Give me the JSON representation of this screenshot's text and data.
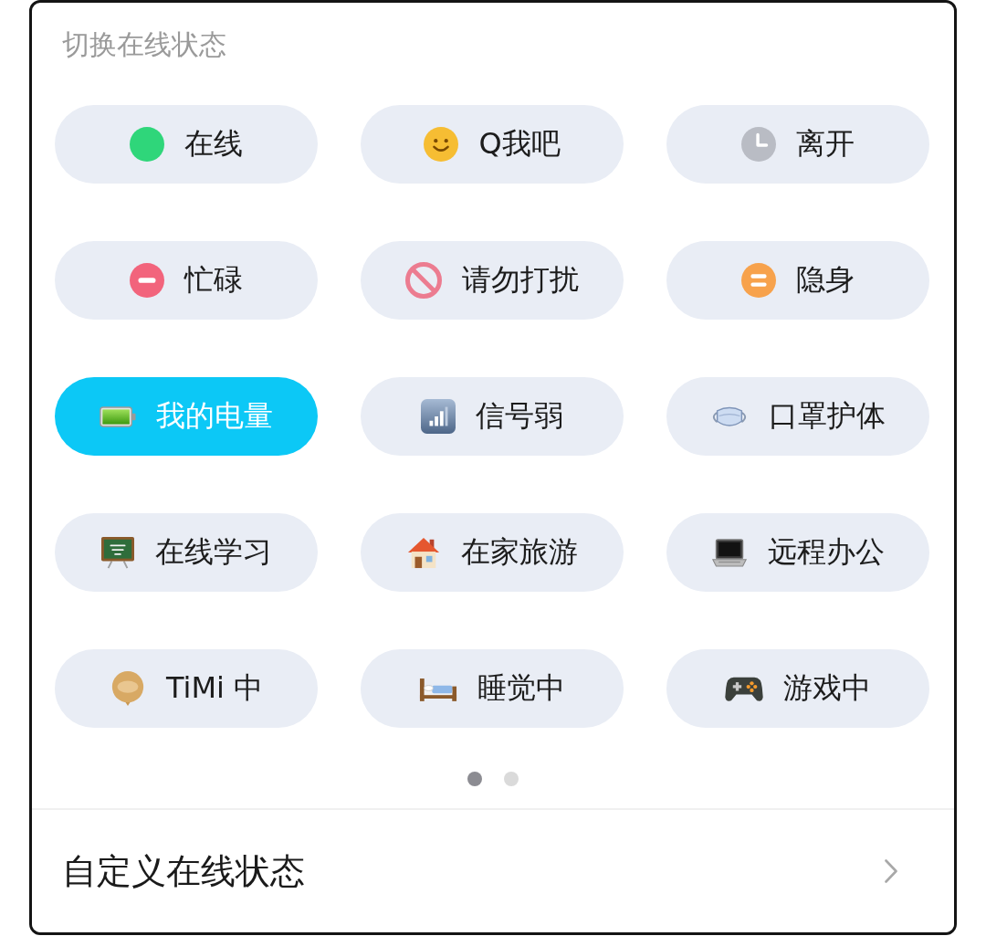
{
  "panel": {
    "title": "切换在线状态"
  },
  "statuses": [
    {
      "label": "在线",
      "kind": "dot",
      "color": "#2fd67a",
      "selected": false
    },
    {
      "label": "Q我吧",
      "kind": "smiley",
      "color": "#f6bd33",
      "selected": false
    },
    {
      "label": "离开",
      "kind": "clock",
      "color": "#b9bcc4",
      "selected": false
    },
    {
      "label": "忙碌",
      "kind": "minus",
      "color": "#f2647c",
      "selected": false
    },
    {
      "label": "请勿打扰",
      "kind": "forbidden",
      "color": "#ec7c90",
      "selected": false
    },
    {
      "label": "隐身",
      "kind": "equals",
      "color": "#f7a24c",
      "selected": false
    },
    {
      "label": "我的电量",
      "kind": "battery",
      "selected": true
    },
    {
      "label": "信号弱",
      "kind": "signal",
      "selected": false
    },
    {
      "label": "口罩护体",
      "kind": "mask",
      "selected": false
    },
    {
      "label": "在线学习",
      "kind": "chalkboard",
      "selected": false
    },
    {
      "label": "在家旅游",
      "kind": "house",
      "selected": false
    },
    {
      "label": "远程办公",
      "kind": "laptop",
      "selected": false
    },
    {
      "label": "TiMi 中",
      "kind": "bubble",
      "selected": false
    },
    {
      "label": "睡觉中",
      "kind": "bed",
      "selected": false
    },
    {
      "label": "游戏中",
      "kind": "gamepad",
      "selected": false
    }
  ],
  "pages": [
    {
      "selected": true
    },
    {
      "selected": false
    }
  ],
  "custom_status": {
    "label": "自定义在线状态"
  }
}
